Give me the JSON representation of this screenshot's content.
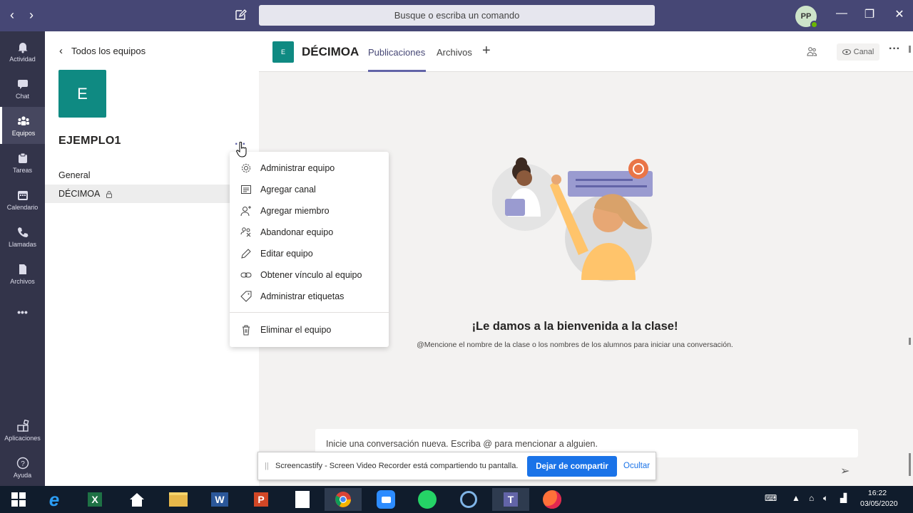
{
  "topbar": {
    "search_placeholder": "Busque o escriba un comando",
    "avatar_initials": "PP"
  },
  "rail": {
    "items": [
      {
        "label": "Actividad",
        "icon": "bell-icon"
      },
      {
        "label": "Chat",
        "icon": "chat-icon"
      },
      {
        "label": "Equipos",
        "icon": "teams-icon"
      },
      {
        "label": "Tareas",
        "icon": "assignments-icon"
      },
      {
        "label": "Calendario",
        "icon": "calendar-icon"
      },
      {
        "label": "Llamadas",
        "icon": "phone-icon"
      },
      {
        "label": "Archivos",
        "icon": "file-icon"
      }
    ],
    "more": "•••",
    "bottom": [
      {
        "label": "Aplicaciones",
        "icon": "apps-icon"
      },
      {
        "label": "Ayuda",
        "icon": "help-icon"
      }
    ]
  },
  "team_panel": {
    "back_label": "Todos los equipos",
    "team_initial": "E",
    "team_name": "EJEMPLO1",
    "channels": [
      {
        "name": "General"
      },
      {
        "name": "DÉCIMOA"
      }
    ]
  },
  "menu": {
    "items": [
      {
        "label": "Administrar equipo",
        "icon": "gear-icon"
      },
      {
        "label": "Agregar canal",
        "icon": "channel-icon"
      },
      {
        "label": "Agregar miembro",
        "icon": "add-member-icon"
      },
      {
        "label": "Abandonar equipo",
        "icon": "leave-icon"
      },
      {
        "label": "Editar equipo",
        "icon": "pencil-icon"
      },
      {
        "label": "Obtener vínculo al equipo",
        "icon": "link-icon"
      },
      {
        "label": "Administrar etiquetas",
        "icon": "tag-icon"
      }
    ],
    "delete_label": "Eliminar el equipo"
  },
  "channel_header": {
    "tile_initial": "E",
    "title": "DÉCIMOA",
    "tabs": [
      "Publicaciones",
      "Archivos"
    ],
    "canal_label": "Canal"
  },
  "welcome": {
    "title": "¡Le damos a la bienvenida a la clase!",
    "subtitle": "@Mencione el nombre de la clase o los nombres de los alumnos para iniciar una conversación."
  },
  "composer": {
    "placeholder": "Inicie una conversación nueva. Escriba @ para mencionar a alguien."
  },
  "share_bar": {
    "text": "Screencastify - Screen Video Recorder está compartiendo tu pantalla.",
    "stop_label": "Dejar de compartir",
    "hide_label": "Ocultar"
  },
  "taskbar": {
    "time": "16:22",
    "date": "03/05/2020"
  },
  "colors": {
    "brand": "#464775",
    "accent": "#6264a7",
    "team_tile": "#0f8a82",
    "share_blue": "#1a73e8"
  }
}
